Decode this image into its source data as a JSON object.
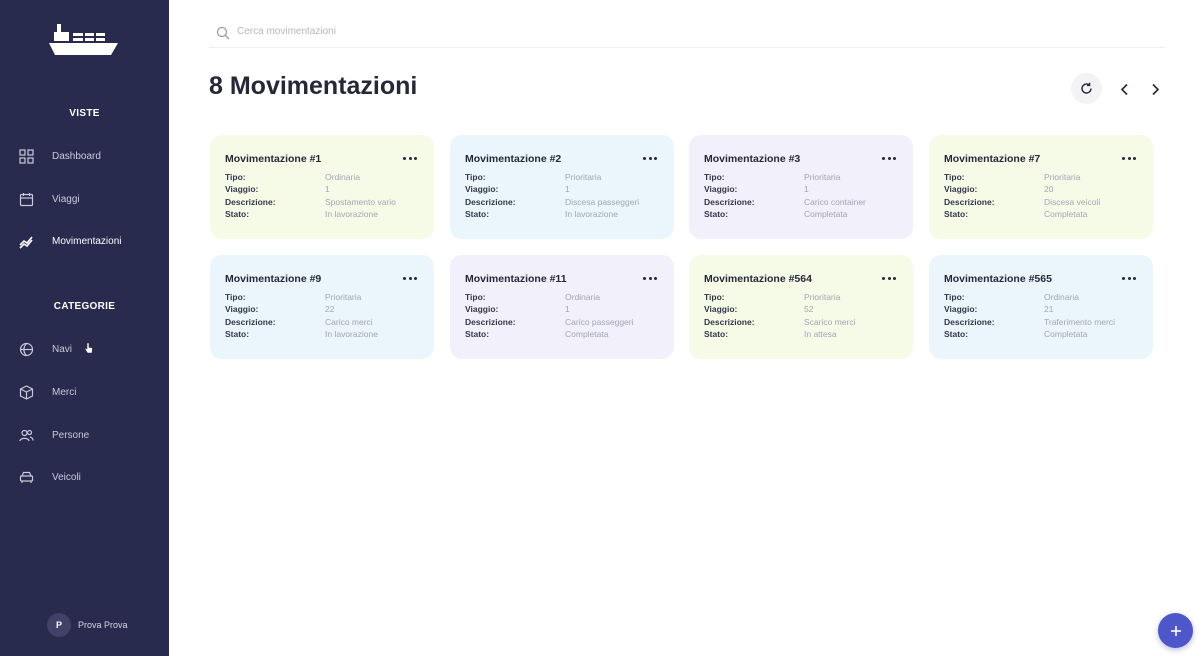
{
  "sidebar": {
    "section_views": "VISTE",
    "section_categories": "CATEGORIE",
    "views": [
      {
        "label": "Dashboard",
        "icon": "grid-icon"
      },
      {
        "label": "Viaggi",
        "icon": "calendar-icon"
      },
      {
        "label": "Movimentazioni",
        "icon": "trend-icon",
        "active": true
      }
    ],
    "categories": [
      {
        "label": "Navi",
        "icon": "globe-icon"
      },
      {
        "label": "Merci",
        "icon": "box-icon"
      },
      {
        "label": "Persone",
        "icon": "users-icon"
      },
      {
        "label": "Veicoli",
        "icon": "car-icon"
      }
    ],
    "user": {
      "initial": "P",
      "name": "Prova Prova"
    }
  },
  "search": {
    "placeholder": "Cerca movimentazioni",
    "value": ""
  },
  "header": {
    "title": "8 Movimentazioni"
  },
  "field_labels": {
    "tipo": "Tipo:",
    "viaggio": "Viaggio:",
    "descrizione": "Descrizione:",
    "stato": "Stato:"
  },
  "cards": [
    {
      "title": "Movimentazione #1",
      "tipo": "Ordinaria",
      "viaggio": "1",
      "descrizione": "Spostamento vario",
      "stato": "In lavorazione",
      "color": "#f6fbe7"
    },
    {
      "title": "Movimentazione #2",
      "tipo": "Prioritaria",
      "viaggio": "1",
      "descrizione": "Discesa passeggeri",
      "stato": "In lavorazione",
      "color": "#eaf6fb"
    },
    {
      "title": "Movimentazione #3",
      "tipo": "Prioritaria",
      "viaggio": "1",
      "descrizione": "Carico container",
      "stato": "Completata",
      "color": "#f1f0fb"
    },
    {
      "title": "Movimentazione #7",
      "tipo": "Prioritaria",
      "viaggio": "20",
      "descrizione": "Discesa veicoli",
      "stato": "Completata",
      "color": "#f6fbe7"
    },
    {
      "title": "Movimentazione #9",
      "tipo": "Prioritaria",
      "viaggio": "22",
      "descrizione": "Carico merci",
      "stato": "In lavorazione",
      "color": "#eaf6fb"
    },
    {
      "title": "Movimentazione #11",
      "tipo": "Ordinaria",
      "viaggio": "1",
      "descrizione": "Carico passeggeri",
      "stato": "Completata",
      "color": "#f1f0fb"
    },
    {
      "title": "Movimentazione #564",
      "tipo": "Prioritaria",
      "viaggio": "52",
      "descrizione": "Scarico merci",
      "stato": "In attesa",
      "color": "#f6fbe7"
    },
    {
      "title": "Movimentazione #565",
      "tipo": "Ordinaria",
      "viaggio": "21",
      "descrizione": "Traferimento merci",
      "stato": "Completata",
      "color": "#eaf6fb"
    }
  ],
  "colors": {
    "sidebar": "#282a4e",
    "accent": "#4d57c9"
  }
}
